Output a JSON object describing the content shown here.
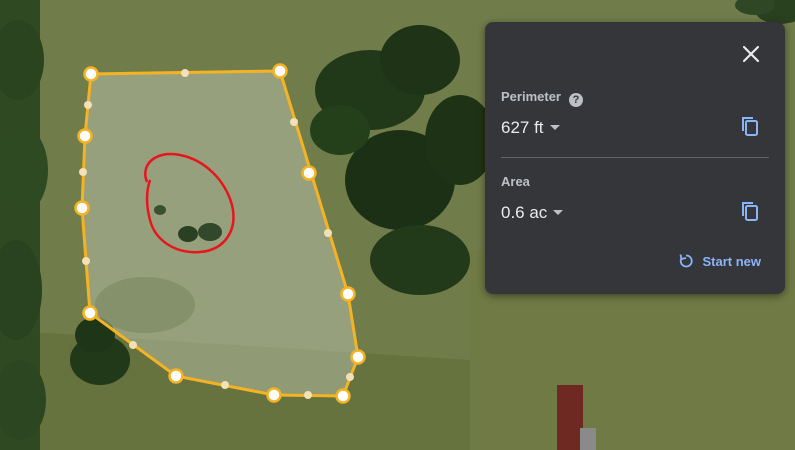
{
  "map": {
    "type": "satellite-aerial",
    "measured_shape_color": "#f5b324",
    "annotation_color": "#e8141e"
  },
  "panel": {
    "close_icon": "close-icon",
    "perimeter": {
      "label": "Perimeter",
      "help_icon": "help-icon",
      "value": "627 ft",
      "copy_icon": "copy-icon"
    },
    "area": {
      "label": "Area",
      "value": "0.6 ac",
      "copy_icon": "copy-icon"
    },
    "start_new": {
      "label": "Start new",
      "icon": "restart-icon",
      "color": "#8ab4f8"
    }
  }
}
